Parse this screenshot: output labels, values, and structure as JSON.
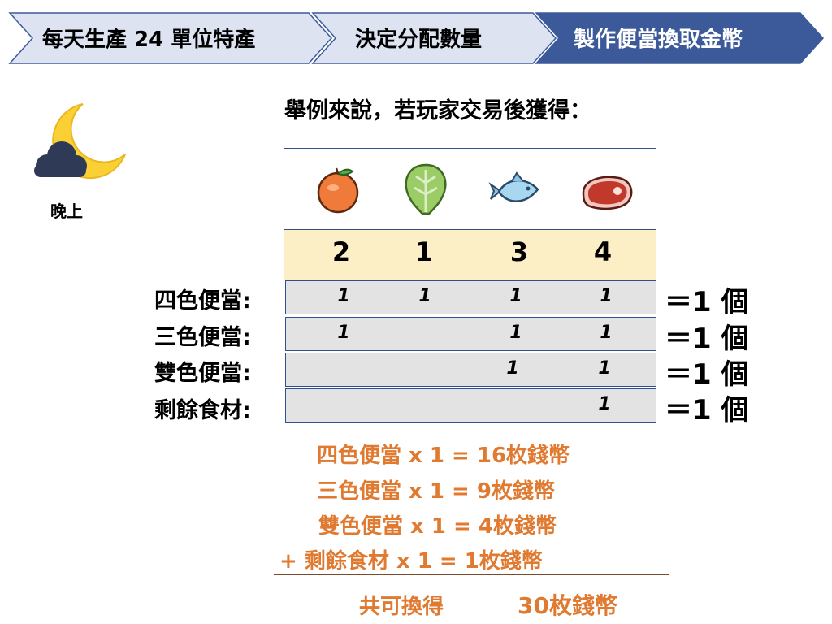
{
  "steps": [
    {
      "label": "每天生產 24 單位特產",
      "active": false
    },
    {
      "label": "決定分配數量",
      "active": false
    },
    {
      "label": "製作便當換取金幣",
      "active": true
    }
  ],
  "time_of_day": {
    "icon": "moon-cloud-icon",
    "label": "晚上"
  },
  "heading": "舉例來說，若玩家交易後獲得：",
  "ingredients": [
    {
      "icon": "orange-icon",
      "qty": "2"
    },
    {
      "icon": "lettuce-icon",
      "qty": "1"
    },
    {
      "icon": "fish-icon",
      "qty": "3"
    },
    {
      "icon": "meat-icon",
      "qty": "4"
    }
  ],
  "bento_rows": [
    {
      "label": "四色便當:",
      "cells": [
        "1",
        "1",
        "1",
        "1"
      ],
      "result": "＝1 個"
    },
    {
      "label": "三色便當:",
      "cells": [
        "1",
        "",
        "1",
        "1"
      ],
      "result": "＝1 個"
    },
    {
      "label": "雙色便當:",
      "cells": [
        "",
        "",
        "1",
        "1"
      ],
      "result": "＝1 個"
    },
    {
      "label": "剩餘食材:",
      "cells": [
        "",
        "",
        "",
        "1"
      ],
      "result": "＝1 個"
    }
  ],
  "sums": [
    {
      "text": "四色便當 x 1 = 16枚錢幣"
    },
    {
      "text": "三色便當 x 1 =  9枚錢幣"
    },
    {
      "text": "雙色便當 x 1 =  4枚錢幣"
    },
    {
      "text": "+  剩餘食材 x 1 =  1枚錢幣"
    }
  ],
  "total": {
    "label": "共可換得",
    "value": "30枚錢幣"
  },
  "colors": {
    "step_inactive": "#dde3f0",
    "step_active": "#3c5a9a",
    "border": "#2f4f8f",
    "qty_bg": "#fcefc6",
    "row_bg": "#e3e3e3",
    "sum_text": "#e07a30"
  }
}
